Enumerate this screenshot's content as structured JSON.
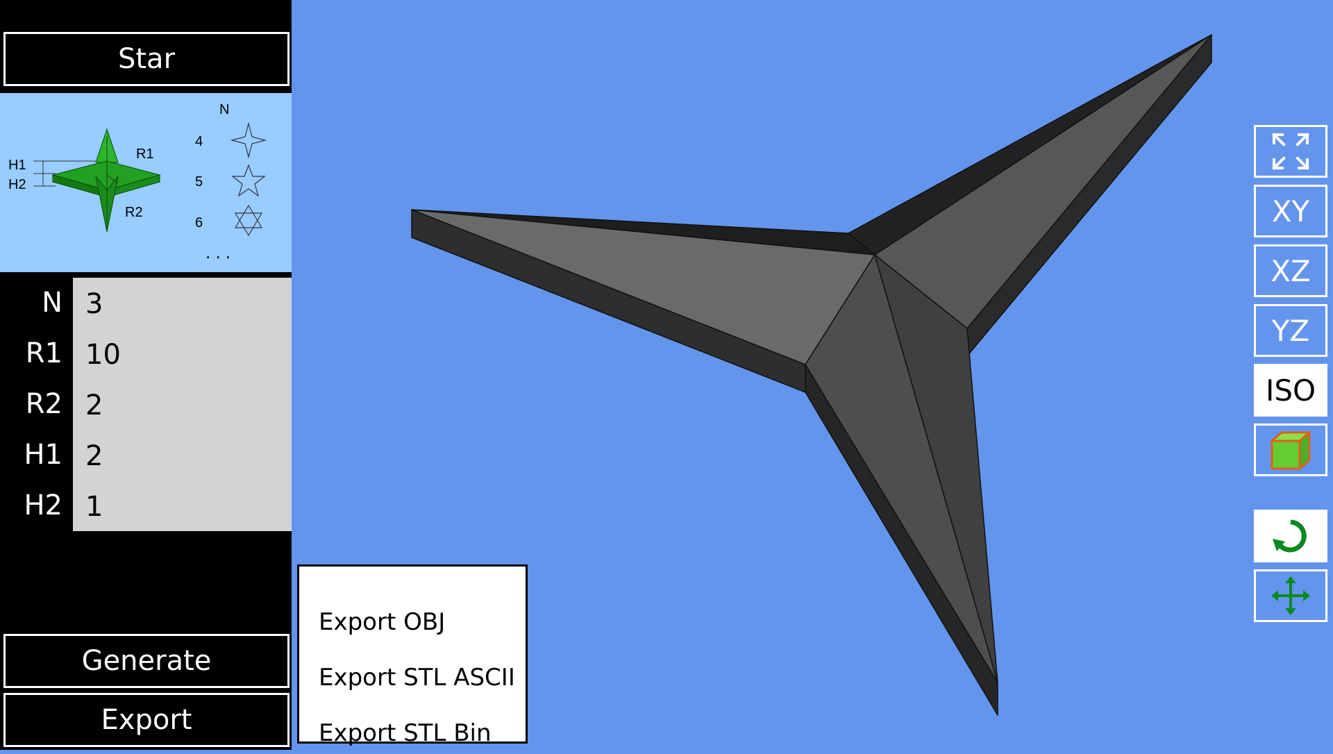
{
  "app": {
    "title_button": "Star",
    "generate_button": "Generate",
    "export_button": "Export"
  },
  "diagram": {
    "n_header": "N",
    "rows": [
      {
        "n": "4",
        "icon": "four-point-star-icon"
      },
      {
        "n": "5",
        "icon": "five-point-star-icon"
      },
      {
        "n": "6",
        "icon": "six-point-star-icon"
      }
    ],
    "ellipsis": ". . .",
    "labels": {
      "h1": "H1",
      "h2": "H2",
      "r1": "R1",
      "r2": "R2"
    }
  },
  "params": [
    {
      "label": "N",
      "value": "3"
    },
    {
      "label": "R1",
      "value": "10"
    },
    {
      "label": "R2",
      "value": "2"
    },
    {
      "label": "H1",
      "value": "2"
    },
    {
      "label": "H2",
      "value": "1"
    }
  ],
  "export_menu": {
    "items": [
      "Export OBJ",
      "Export STL ASCII",
      "Export STL Bin"
    ]
  },
  "view_buttons": {
    "fit_icon": "fit-to-view-icon",
    "xy": "XY",
    "xz": "XZ",
    "yz": "YZ",
    "iso": "ISO",
    "solid_icon": "green-cube-icon",
    "rotate_icon": "rotate-icon",
    "pan_icon": "move-arrows-icon"
  },
  "colors": {
    "background": "#6495ED",
    "sidebar": "#000000",
    "diagram_bg": "#99CCFF",
    "input_bg": "#D3D3D3",
    "model": "#4A4A4A",
    "accent_green": "#008000"
  }
}
